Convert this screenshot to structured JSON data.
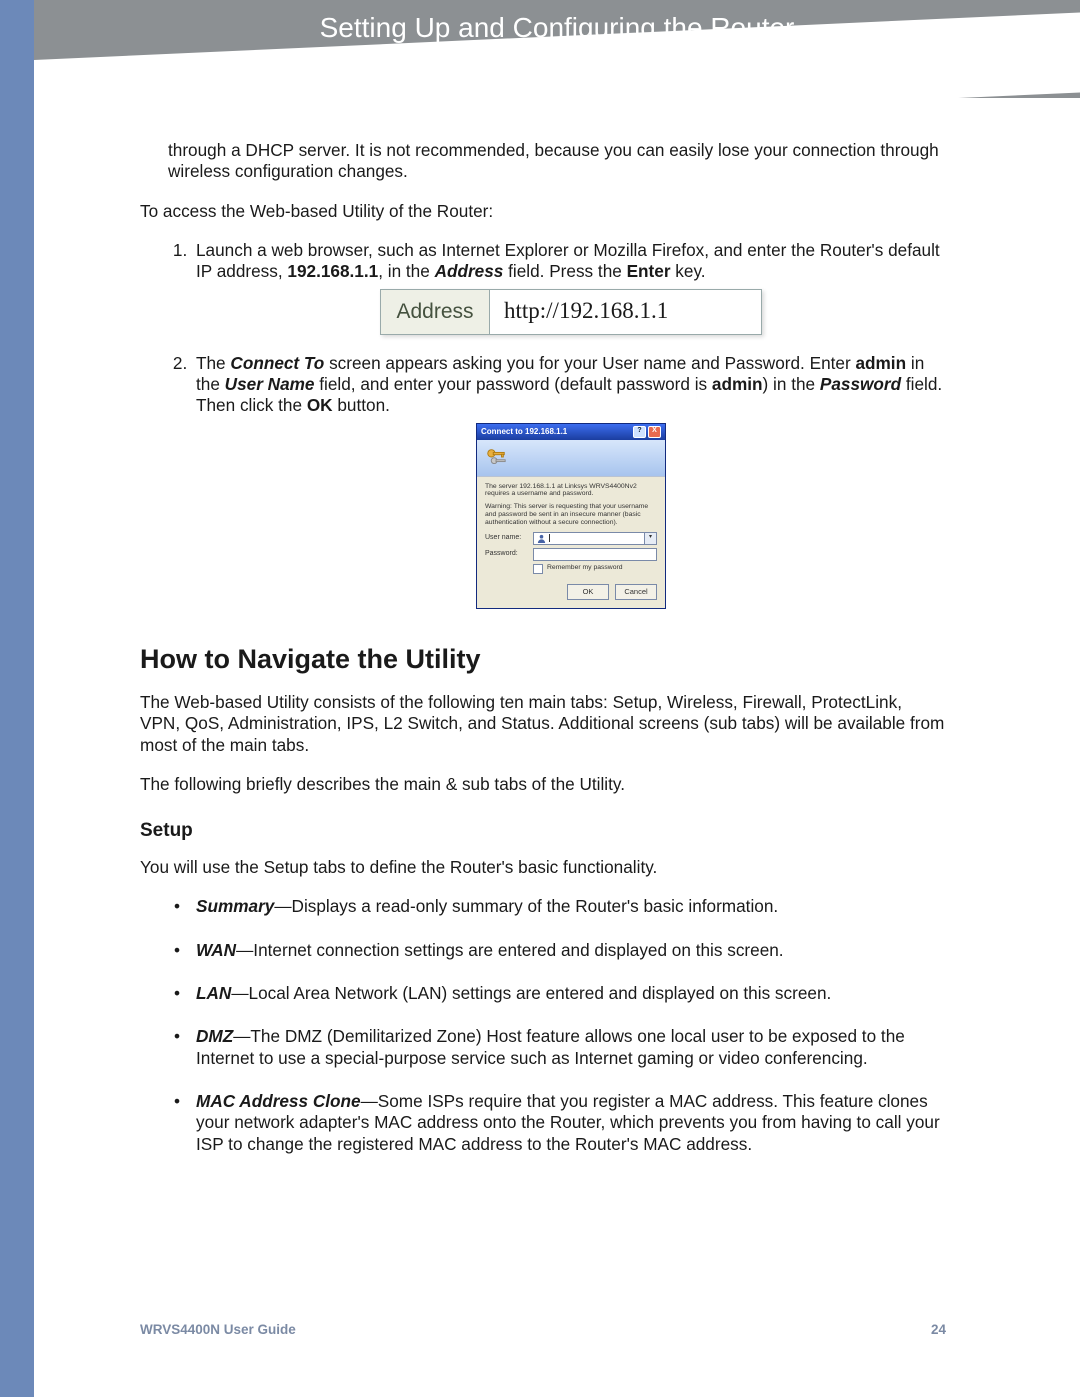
{
  "header": {
    "title": "Setting Up and Configuring the Router",
    "subtitle": "How to Navigate the Utility"
  },
  "leadin": "through a DHCP server. It is not recommended, because you can easily lose your connection through wireless configuration changes.",
  "access_line": "To access the Web-based Utility of the Router:",
  "step1": {
    "a": "Launch a web browser, such as Internet Explorer or Mozilla Firefox, and enter the Router's default IP address, ",
    "ip": "192.168.1.1",
    "b": ", in the ",
    "addrword": "Address",
    "c": " field. Press the ",
    "enter": "Enter",
    "d": " key."
  },
  "addrbar": {
    "label": "Address",
    "url": "http://192.168.1.1"
  },
  "step2": {
    "a": "The ",
    "connect": "Connect To",
    "b": " screen appears asking you for your User name and Password. Enter ",
    "admin1": "admin",
    "c": " in the ",
    "uname": "User Name",
    "d": " field, and enter your password (default password is ",
    "admin2": "admin",
    "e": ") in the ",
    "pword": "Password",
    "f": " field. Then click the ",
    "ok": "OK",
    "g": " button."
  },
  "dialog": {
    "title": "Connect to 192.168.1.1",
    "msg1": "The server 192.168.1.1 at Linksys WRVS4400Nv2 requires a username and password.",
    "msg2": "Warning: This server is requesting that your username and password be sent in an insecure manner (basic authentication without a secure connection).",
    "user_label": "User name:",
    "pass_label": "Password:",
    "remember": "Remember my password",
    "ok": "OK",
    "cancel": "Cancel"
  },
  "nav_heading": "How to Navigate the Utility",
  "nav_p1": "The Web-based Utility consists of the following ten main tabs: Setup, Wireless, Firewall, ProtectLink, VPN, QoS, Administration, IPS, L2 Switch,  and Status. Additional screens (sub tabs) will be available from most of the main tabs.",
  "nav_p2": "The following briefly describes the main & sub tabs of the Utility.",
  "setup_heading": "Setup",
  "setup_intro": "You will use the Setup tabs to define the Router's basic functionality.",
  "bullets": {
    "summary": {
      "t": "Summary",
      "d": "—Displays a read-only summary of the Router's basic information."
    },
    "wan": {
      "t": "WAN",
      "d": "—Internet connection settings are entered and displayed on this screen."
    },
    "lan": {
      "t": "LAN",
      "d": "—Local Area Network (LAN) settings are entered and displayed on this screen."
    },
    "dmz": {
      "t": "DMZ",
      "d": "—The DMZ (Demilitarized Zone) Host feature allows one local user to be exposed to the Internet to use a special-purpose service such as Internet gaming or video conferencing."
    },
    "mac": {
      "t": "MAC Address Clone",
      "d": "—Some ISPs require that you register a MAC address. This feature clones your network adapter's MAC address onto the Router, which prevents you from having to call your ISP to change the registered MAC address to the Router's MAC address."
    }
  },
  "footer": {
    "guide": "WRVS4400N User Guide",
    "page": "24"
  }
}
